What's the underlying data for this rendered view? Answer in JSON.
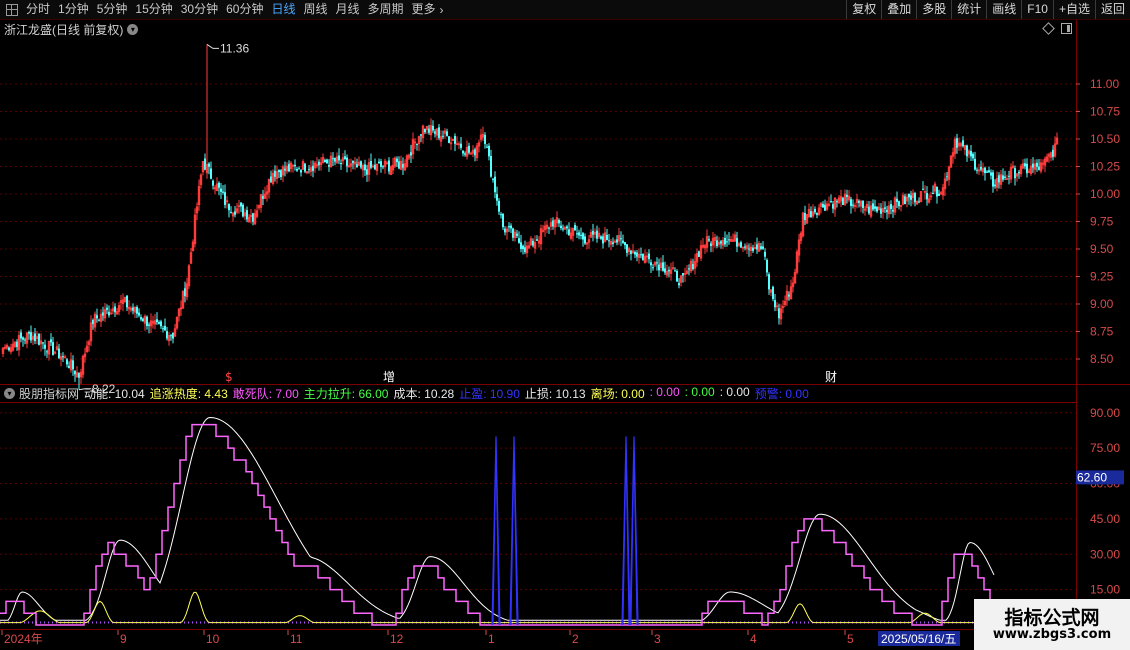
{
  "toolbar": {
    "periods": [
      "分时",
      "1分钟",
      "5分钟",
      "15分钟",
      "30分钟",
      "60分钟",
      "日线",
      "周线",
      "月线",
      "多周期",
      "更多"
    ],
    "active_period": "日线",
    "right_buttons": [
      "复权",
      "叠加",
      "多股",
      "统计",
      "画线",
      "F10",
      "+自选",
      "返回"
    ]
  },
  "stock_title": "浙江龙盛(日线 前复权)",
  "colors": {
    "up": "#ff3b3b",
    "down": "#55ffff",
    "grid": "#5a0000",
    "axis_text": "#d84a4a",
    "heat": "#ff66ff",
    "dong": "#ffffff",
    "zhui": "#ffff55",
    "stop": "#3333ff",
    "zero": "#b050ff"
  },
  "price_axis": {
    "ticks": [
      "11.00",
      "10.75",
      "10.50",
      "10.25",
      "10.00",
      "9.75",
      "9.50",
      "9.25",
      "9.00",
      "8.75",
      "8.50"
    ]
  },
  "annotations": {
    "high": "11.36",
    "low": "8.22"
  },
  "event_marks": [
    "$",
    "增",
    "财"
  ],
  "indicator": {
    "name": "股朋指标网",
    "items": [
      {
        "label": "动能",
        "value": "10.04",
        "color": "#e8e8e8"
      },
      {
        "label": "追涨热度",
        "value": "4.43",
        "color": "#ffff55"
      },
      {
        "label": "敢死队",
        "value": "7.00",
        "color": "#ff55ff"
      },
      {
        "label": "主力拉升",
        "value": "66.00",
        "color": "#44ff44"
      },
      {
        "label": "成本",
        "value": "10.28",
        "color": "#e8e8e8"
      },
      {
        "label": "止盈",
        "value": "10.90",
        "color": "#3333ff"
      },
      {
        "label": "止损",
        "value": "10.13",
        "color": "#e8e8e8"
      },
      {
        "label": "离场",
        "value": "0.00",
        "color": "#ffff55"
      },
      {
        "label": "",
        "value": "0.00",
        "color": "#ff55ff"
      },
      {
        "label": "",
        "value": "0.00",
        "color": "#44ff44"
      },
      {
        "label": "",
        "value": "0.00",
        "color": "#e8e8e8"
      },
      {
        "label": "预警",
        "value": "0.00",
        "color": "#3333ff"
      }
    ]
  },
  "indicator_axis": {
    "ticks": [
      "90.00",
      "75.00",
      "60.00",
      "45.00",
      "30.00",
      "15.00"
    ],
    "cursor_value": "62.60"
  },
  "date_axis": {
    "labels": [
      "2024年",
      "9",
      "10",
      "11",
      "12",
      "1",
      "2",
      "3",
      "4",
      "5"
    ],
    "current_date": "2025/05/16/五"
  },
  "watermark": {
    "line1": "指标公式网",
    "line2": "www.zbgs3.com"
  },
  "chart_data": {
    "type": "candlestick",
    "price_ylim": [
      8.3,
      11.4
    ],
    "indicator_ylim": [
      0,
      95
    ],
    "key_closes": [
      [
        0,
        8.6
      ],
      [
        14,
        8.72
      ],
      [
        30,
        8.52
      ],
      [
        38,
        8.35
      ],
      [
        45,
        8.85
      ],
      [
        60,
        9.02
      ],
      [
        75,
        8.8
      ],
      [
        85,
        8.72
      ],
      [
        92,
        9.2
      ],
      [
        100,
        10.3
      ],
      [
        103,
        10.2
      ],
      [
        112,
        9.9
      ],
      [
        125,
        9.8
      ],
      [
        135,
        10.2
      ],
      [
        150,
        10.25
      ],
      [
        165,
        10.3
      ],
      [
        180,
        10.22
      ],
      [
        200,
        10.28
      ],
      [
        210,
        10.6
      ],
      [
        225,
        10.5
      ],
      [
        235,
        10.35
      ],
      [
        240,
        10.6
      ],
      [
        243,
        10.3
      ],
      [
        250,
        9.7
      ],
      [
        262,
        9.5
      ],
      [
        275,
        9.75
      ],
      [
        290,
        9.6
      ],
      [
        305,
        9.6
      ],
      [
        318,
        9.45
      ],
      [
        330,
        9.35
      ],
      [
        340,
        9.2
      ],
      [
        350,
        9.55
      ],
      [
        360,
        9.6
      ],
      [
        372,
        9.55
      ],
      [
        380,
        9.5
      ],
      [
        383,
        9.15
      ],
      [
        388,
        8.9
      ],
      [
        395,
        9.2
      ],
      [
        400,
        9.8
      ],
      [
        410,
        9.9
      ],
      [
        420,
        9.95
      ],
      [
        435,
        9.85
      ],
      [
        445,
        9.9
      ],
      [
        460,
        10.0
      ],
      [
        470,
        10.05
      ],
      [
        476,
        10.5
      ],
      [
        485,
        10.3
      ],
      [
        495,
        10.1
      ],
      [
        505,
        10.2
      ],
      [
        520,
        10.25
      ],
      [
        527,
        10.45
      ]
    ],
    "low_point": 8.22,
    "high_point": 11.36,
    "series_names": [
      "动能",
      "追涨热度",
      "敢死队",
      "主力拉升",
      "止盈",
      "预警"
    ]
  }
}
